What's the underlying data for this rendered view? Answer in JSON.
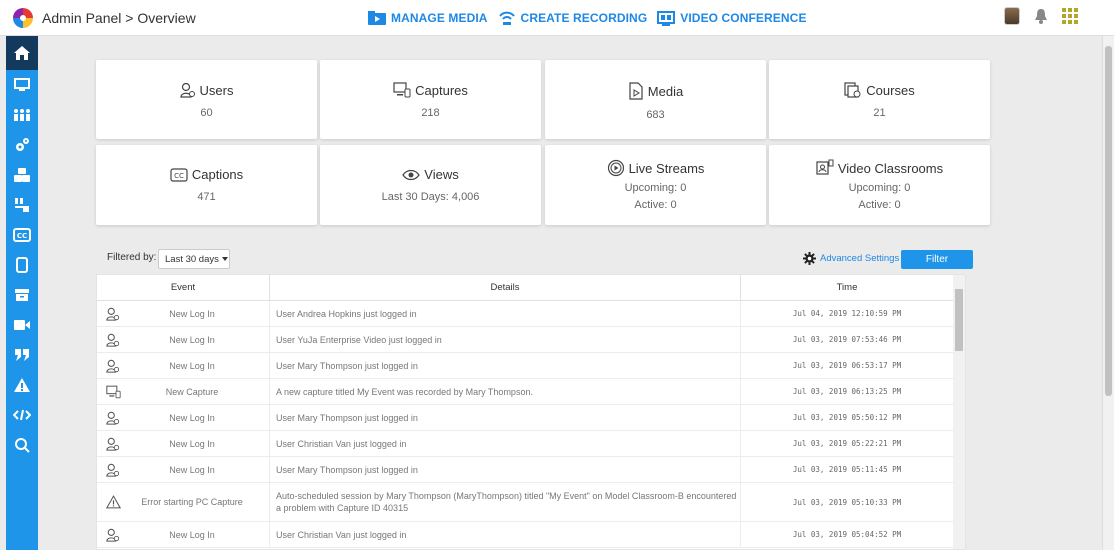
{
  "header": {
    "breadcrumb": "Admin Panel > Overview",
    "nav": [
      {
        "label": "MANAGE MEDIA",
        "icon": "media-folder-icon"
      },
      {
        "label": "CREATE RECORDING",
        "icon": "broadcast-icon"
      },
      {
        "label": "VIDEO CONFERENCE",
        "icon": "conference-icon"
      }
    ]
  },
  "sidebar": {
    "items": [
      "home-icon",
      "monitor-icon",
      "people-icon",
      "gears-icon",
      "cubes-icon",
      "classroom-icon",
      "captions-icon",
      "mobile-icon",
      "archive-icon",
      "video-camera-icon",
      "quote-icon",
      "warning-icon",
      "code-icon",
      "search-analytics-icon"
    ]
  },
  "cards": {
    "users": {
      "title": "Users",
      "value": "60"
    },
    "captures": {
      "title": "Captures",
      "value": "218"
    },
    "media": {
      "title": "Media",
      "value": "683"
    },
    "courses": {
      "title": "Courses",
      "value": "21"
    },
    "captions": {
      "title": "Captions",
      "value": "471"
    },
    "views": {
      "title": "Views",
      "value": "Last 30 Days: 4,006"
    },
    "live": {
      "title": "Live Streams",
      "upcoming": "Upcoming: 0",
      "active": "Active: 0"
    },
    "classrooms": {
      "title": "Video Classrooms",
      "upcoming": "Upcoming: 0",
      "active": "Active: 0"
    }
  },
  "filter": {
    "label": "Filtered by:",
    "selected": "Last 30 days",
    "advanced": "Advanced Settings",
    "button": "Filter"
  },
  "table": {
    "headers": {
      "event": "Event",
      "details": "Details",
      "time": "Time"
    },
    "rows": [
      {
        "icon": "user-icon",
        "event": "New Log In",
        "details": "User Andrea Hopkins just logged in",
        "time": "Jul 04, 2019 12:10:59 PM"
      },
      {
        "icon": "user-icon",
        "event": "New Log In",
        "details": "User YuJa Enterprise Video just logged in",
        "time": "Jul 03, 2019 07:53:46 PM"
      },
      {
        "icon": "user-icon",
        "event": "New Log In",
        "details": "User Mary Thompson just logged in",
        "time": "Jul 03, 2019 06:53:17 PM"
      },
      {
        "icon": "capture-icon",
        "event": "New Capture",
        "details": "A new capture titled My Event was recorded by Mary Thompson.",
        "time": "Jul 03, 2019 06:13:25 PM"
      },
      {
        "icon": "user-icon",
        "event": "New Log In",
        "details": "User Mary Thompson just logged in",
        "time": "Jul 03, 2019 05:50:12 PM"
      },
      {
        "icon": "user-icon",
        "event": "New Log In",
        "details": "User Christian Van just logged in",
        "time": "Jul 03, 2019 05:22:21 PM"
      },
      {
        "icon": "user-icon",
        "event": "New Log In",
        "details": "User Mary Thompson just logged in",
        "time": "Jul 03, 2019 05:11:45 PM"
      },
      {
        "icon": "warning-icon",
        "event": "Error starting PC Capture",
        "details": "Auto-scheduled session by Mary Thompson (MaryThompson) titled \"My Event\" on Model Classroom-B encountered a problem with Capture ID 40315",
        "time": "Jul 03, 2019 05:10:33 PM"
      },
      {
        "icon": "user-icon",
        "event": "New Log In",
        "details": "User Christian Van just logged in",
        "time": "Jul 03, 2019 05:04:52 PM"
      }
    ]
  },
  "colors": {
    "accent": "#1e95e8",
    "sidebar_active": "#133a5c",
    "link": "#1e88e5"
  }
}
